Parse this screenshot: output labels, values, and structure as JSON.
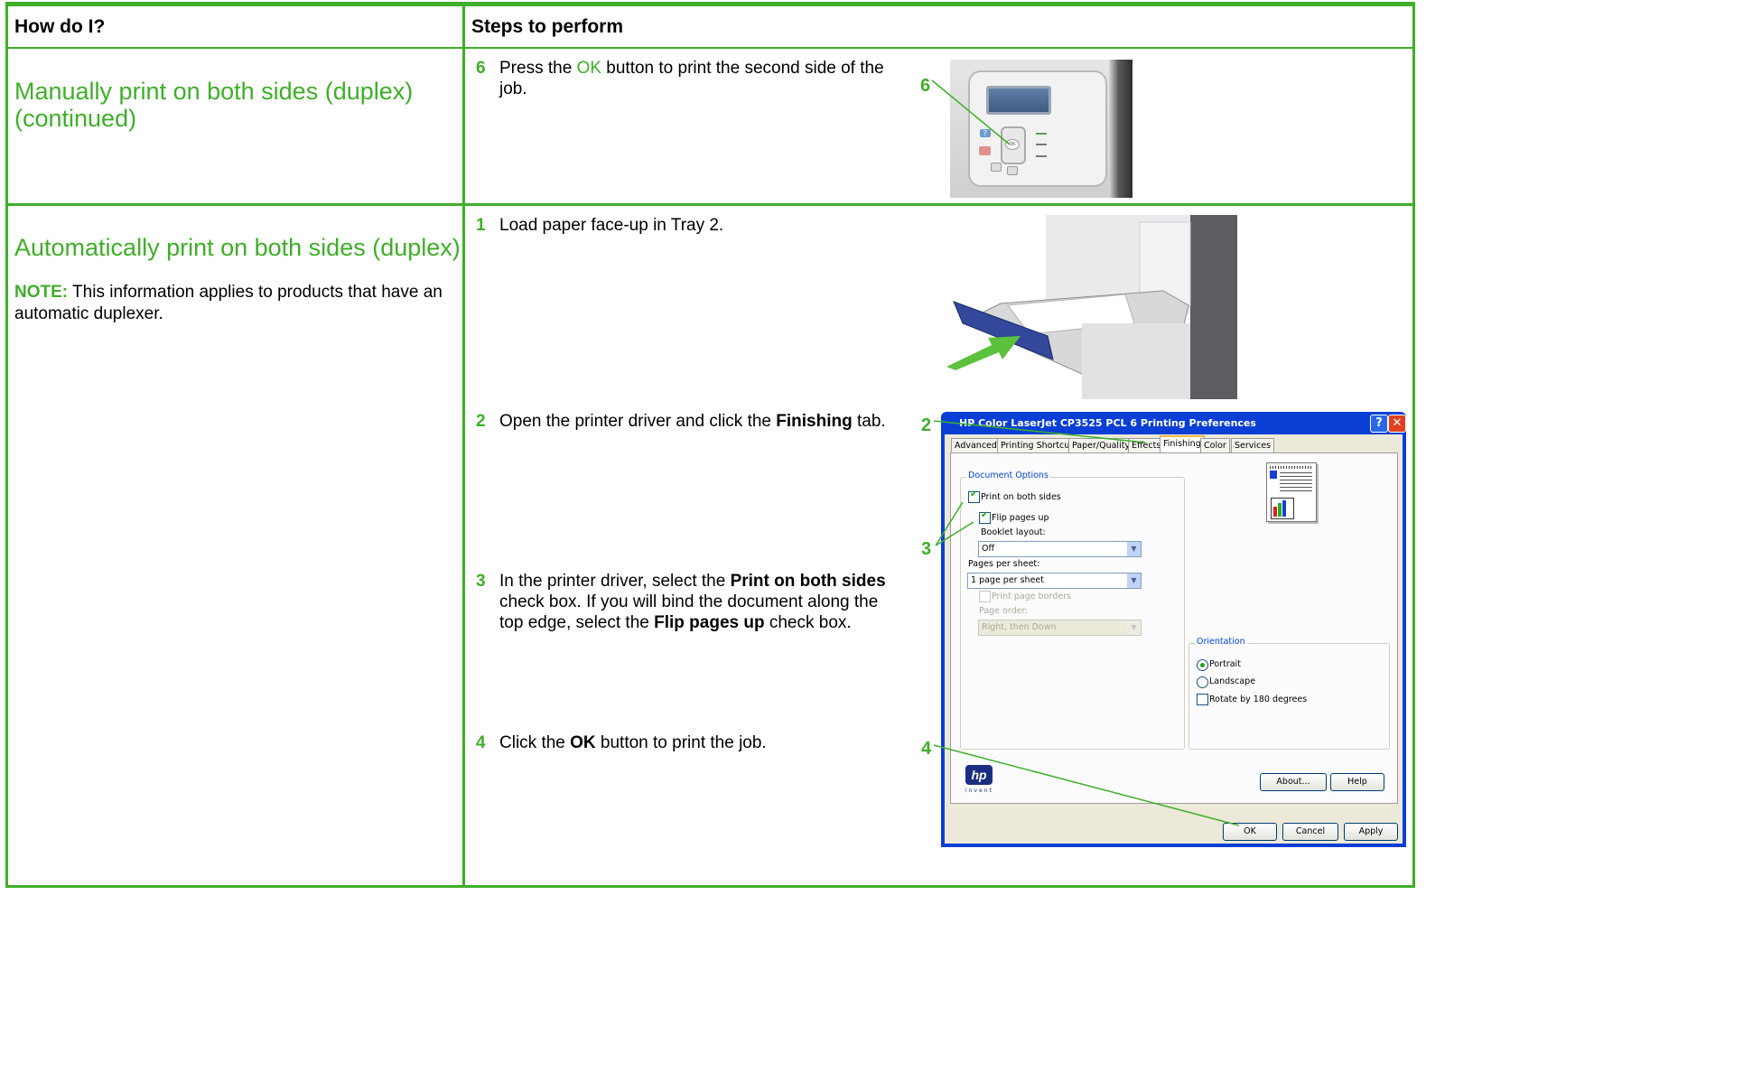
{
  "headers": {
    "how": "How do I?",
    "steps": "Steps to perform"
  },
  "rows": [
    {
      "title_line1": "Manually print on both sides (duplex)",
      "title_line2": "(continued)"
    },
    {
      "title": "Automatically print on both sides (duplex)",
      "note_label": "NOTE:",
      "note_text": " This information applies to products that have an",
      "note_text2": "automatic duplexer."
    }
  ],
  "steps": {
    "s6": {
      "num": "6",
      "pre": "Press the ",
      "ok": "OK",
      "post": " button to print the second side of the",
      "post2": "job."
    },
    "s1": {
      "num": "1",
      "text": "Load paper face-up in Tray 2."
    },
    "s2": {
      "num": "2",
      "pre": "Open the printer driver and click the ",
      "bold": "Finishing",
      "post": " tab."
    },
    "s3": {
      "num": "3",
      "l1_pre": "In the printer driver, select the ",
      "l1_bold": "Print on both sides",
      "l2": "check box. If you will bind the document along the",
      "l3_pre": "top edge, select the ",
      "l3_bold": "Flip pages up",
      "l3_post": " check box."
    },
    "s4": {
      "num": "4",
      "pre": "Click the ",
      "bold": "OK",
      "post": " button to print the job."
    }
  },
  "callouts": {
    "c6": "6",
    "c2": "2",
    "c3": "3",
    "c4": "4"
  },
  "panel": {
    "ok_label": "OK",
    "help_label": "?"
  },
  "dialog": {
    "title": "HP Color LaserJet CP3525 PCL 6 Printing Preferences",
    "help_btn": "?",
    "close_btn": "✕",
    "tabs": [
      "Advanced",
      "Printing Shortcuts",
      "Paper/Quality",
      "Effects",
      "Finishing",
      "Color",
      "Services"
    ],
    "active_tab": "Finishing",
    "doc_options": "Document Options",
    "print_both_sides": "Print on both sides",
    "flip_pages_up": "Flip pages up",
    "booklet_layout": "Booklet layout:",
    "booklet_value": "Off",
    "pages_per_sheet": "Pages per sheet:",
    "pages_value": "1 page per sheet",
    "print_borders": "Print page borders",
    "page_order": "Page order:",
    "page_order_value": "Right, then Down",
    "orientation": "Orientation",
    "portrait": "Portrait",
    "landscape": "Landscape",
    "rotate": "Rotate by 180 degrees",
    "about": "About...",
    "help": "Help",
    "ok": "OK",
    "cancel": "Cancel",
    "apply": "Apply",
    "hp_logo": "hp",
    "invent": "invent"
  },
  "colors": {
    "accent": "#3fae29",
    "dialog_blue": "#0a3fd6"
  }
}
